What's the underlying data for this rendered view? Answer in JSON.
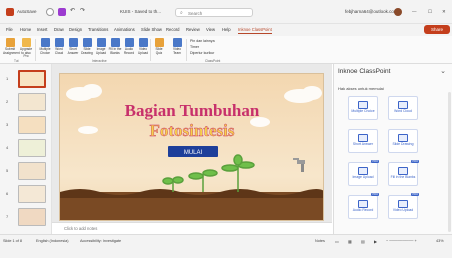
{
  "titlebar": {
    "autosave": "AutoSave",
    "filename": "KUIS - Saved to th...",
    "search_placeholder": "Search",
    "user": "febjharna64@outlook.com"
  },
  "tabs": [
    "File",
    "Home",
    "Insert",
    "Draw",
    "Design",
    "Transitions",
    "Animations",
    "Slide Show",
    "Record",
    "Review",
    "View",
    "Help",
    "Inknoe ClassPoint"
  ],
  "share_label": "Share",
  "ribbon": {
    "buttons": [
      {
        "label": "Submit Assignment",
        "color": "#e8a23a"
      },
      {
        "label": "Upgrade to also Pro",
        "color": "#f0b84c"
      },
      {
        "label": "Multiple Choice",
        "color": "#4a78c8"
      },
      {
        "label": "Word Cloud",
        "color": "#4a78c8"
      },
      {
        "label": "Short Answer",
        "color": "#4a78c8"
      },
      {
        "label": "Slide Drawing",
        "color": "#4a78c8"
      },
      {
        "label": "Image Upload",
        "color": "#4a78c8"
      },
      {
        "label": "Fill in the Blanks",
        "color": "#4a78c8"
      },
      {
        "label": "Audio Record",
        "color": "#4a78c8"
      },
      {
        "label": "Video Upload",
        "color": "#4a78c8"
      },
      {
        "label": "Slide Quiz",
        "color": "#e8a23a"
      },
      {
        "label": "Video Team",
        "color": "#4a78c8"
      }
    ],
    "small_items": [
      "Pin dan lainnya",
      "Timer",
      "Diperlur kurikur"
    ],
    "groups": [
      "Tut",
      "Interactive",
      "ClassPoint"
    ]
  },
  "slides": [
    {
      "num": "1",
      "selected": true
    },
    {
      "num": "2",
      "selected": false
    },
    {
      "num": "3",
      "selected": false
    },
    {
      "num": "4",
      "selected": false
    },
    {
      "num": "5",
      "selected": false
    },
    {
      "num": "6",
      "selected": false
    },
    {
      "num": "7",
      "selected": false
    }
  ],
  "slide": {
    "title_line1": "Bagian Tumbuhan",
    "title_line2": "Fotosintesis",
    "mulai_label": "MULAI"
  },
  "notes_placeholder": "Click to add notes",
  "pane": {
    "title": "Inknoe ClassPoint",
    "subtitle": "Hak akses untuk memulai",
    "cards": [
      {
        "label": "Multiple Choice",
        "badge": ""
      },
      {
        "label": "Word Cloud",
        "badge": ""
      },
      {
        "label": "Short Answer",
        "badge": ""
      },
      {
        "label": "Slide Drawing",
        "badge": ""
      },
      {
        "label": "Image Upload",
        "badge": "PRO"
      },
      {
        "label": "Fill in the Blanks",
        "badge": "PRO"
      },
      {
        "label": "Audio Record",
        "badge": "PRO"
      },
      {
        "label": "Video Upload",
        "badge": "PRO"
      }
    ]
  },
  "status": {
    "slide_count": "Slide 1 of 8",
    "language": "English (Indonesia)",
    "accessibility": "Accessibility: Investigate",
    "notes": "Notes",
    "zoom": "43%"
  }
}
